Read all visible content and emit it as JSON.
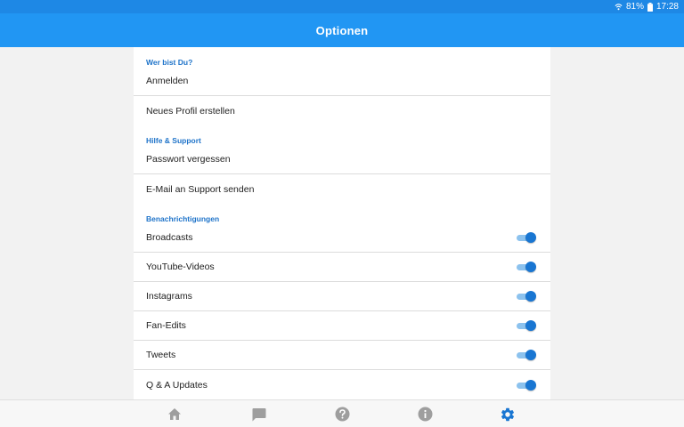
{
  "status_bar": {
    "battery": "81%",
    "time": "17:28"
  },
  "app_bar": {
    "title": "Optionen"
  },
  "sections": {
    "who": {
      "header": "Wer bist Du?",
      "login": "Anmelden",
      "new_profile": "Neues Profil erstellen"
    },
    "help": {
      "header": "Hilfe & Support",
      "forgot_password": "Passwort vergessen",
      "email_support": "E-Mail an Support senden"
    },
    "notifications": {
      "header": "Benachrichtigungen",
      "items": [
        {
          "label": "Broadcasts",
          "enabled": true
        },
        {
          "label": "YouTube-Videos",
          "enabled": true
        },
        {
          "label": "Instagrams",
          "enabled": true
        },
        {
          "label": "Fan-Edits",
          "enabled": true
        },
        {
          "label": "Tweets",
          "enabled": true
        },
        {
          "label": "Q & A Updates",
          "enabled": true
        }
      ]
    }
  },
  "bottom_nav": {
    "items": [
      {
        "icon": "home-icon",
        "active": false
      },
      {
        "icon": "chat-icon",
        "active": false
      },
      {
        "icon": "help-icon",
        "active": false
      },
      {
        "icon": "info-icon",
        "active": false
      },
      {
        "icon": "gear-icon",
        "active": true
      }
    ]
  },
  "colors": {
    "primary": "#2196f3",
    "status_bar": "#1e88e5",
    "accent": "#1976d2",
    "section_header": "#1e73c9",
    "nav_inactive": "#9e9e9e"
  }
}
